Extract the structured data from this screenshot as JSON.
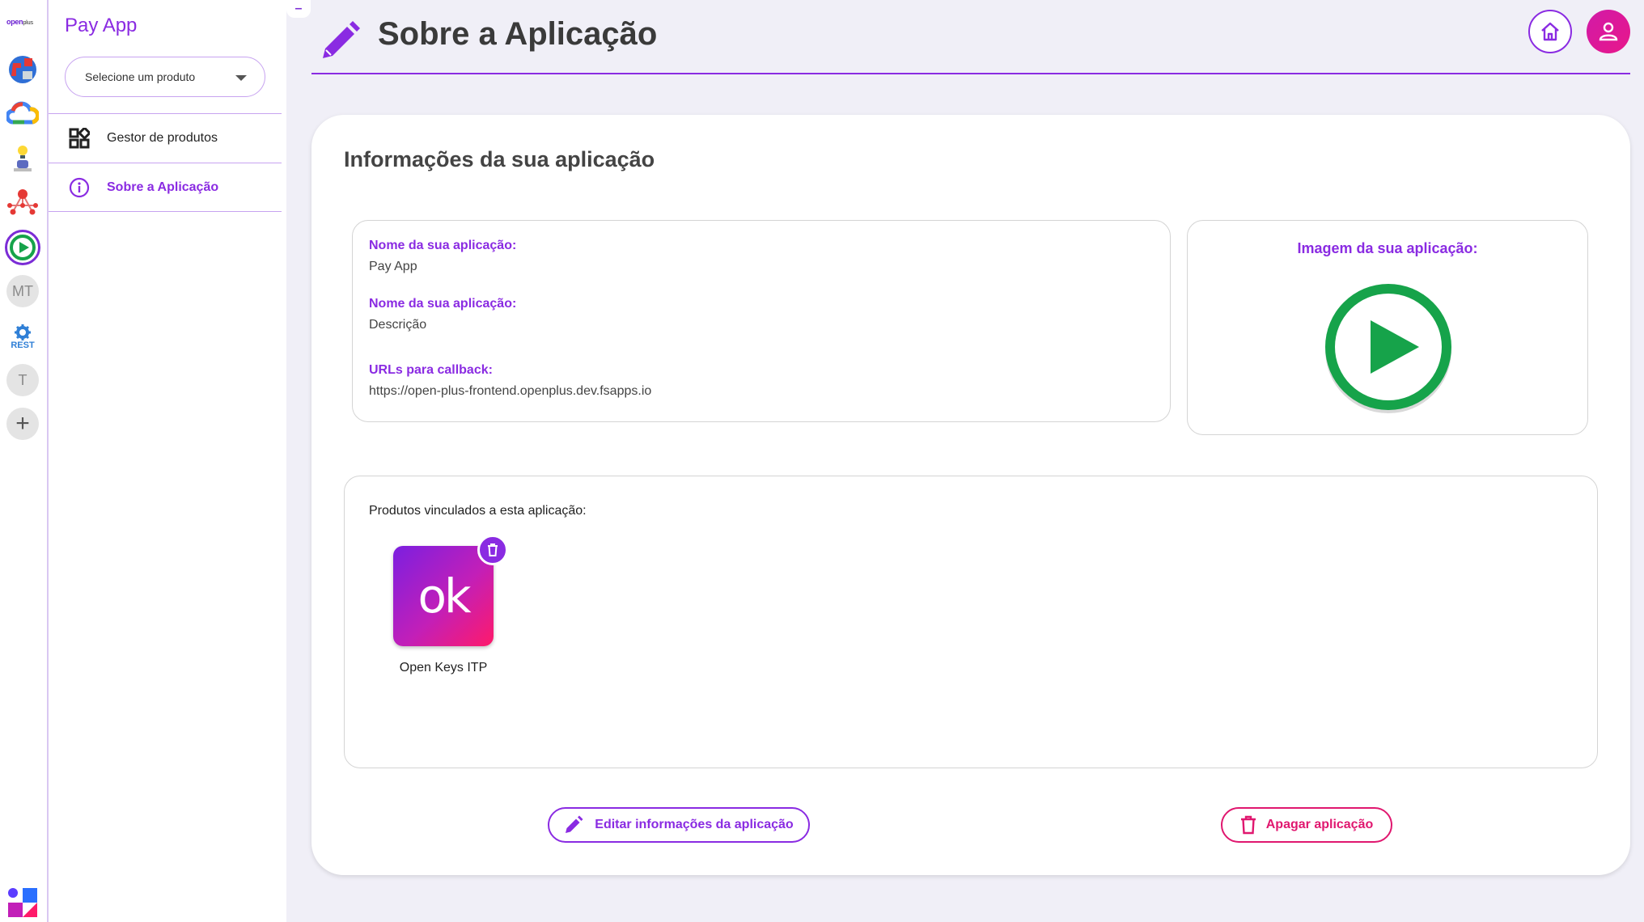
{
  "colors": {
    "accent": "#8a2be2",
    "danger": "#e0176f",
    "background": "#f0eff7",
    "success": "#16a34a"
  },
  "rail": {
    "logo_text": "open",
    "logo_text_bold": "plus",
    "items": [
      {
        "icon": "puzzle-globe-icon"
      },
      {
        "icon": "google-cloud-icon"
      },
      {
        "icon": "person-bulb-icon"
      },
      {
        "icon": "network-nodes-icon"
      },
      {
        "icon": "play-circle-icon",
        "active": true
      },
      {
        "initials": "MT"
      },
      {
        "icon": "rest-gear-icon",
        "text": "REST"
      },
      {
        "initials": "T"
      },
      {
        "icon": "plus-icon",
        "text": "+"
      }
    ]
  },
  "sidebar": {
    "app_name": "Pay App",
    "product_select": {
      "placeholder": "Selecione um produto"
    },
    "nav": [
      {
        "label": "Gestor de produtos",
        "icon": "grid-apps-icon",
        "active": false
      },
      {
        "label": "Sobre a Aplicação",
        "icon": "info-circle-icon",
        "active": true
      }
    ],
    "collapse_label": "–"
  },
  "header": {
    "title": "Sobre a Aplicação"
  },
  "main": {
    "section_title": "Informações da sua aplicação",
    "fields": [
      {
        "label": "Nome da sua aplicação:",
        "value": "Pay App"
      },
      {
        "label": "Nome da sua aplicação:",
        "value": "Descrição"
      },
      {
        "label": "URLs para callback:",
        "value": "https://open-plus-frontend.openplus.dev.fsapps.io"
      }
    ],
    "image_label": "Imagem da sua aplicação:",
    "products_label": "Produtos vinculados a esta aplicação:",
    "products": [
      {
        "name": "Open Keys ITP",
        "logo_text": "ok"
      }
    ],
    "edit_button": "Editar informações da aplicação",
    "delete_button": "Apagar aplicação"
  }
}
